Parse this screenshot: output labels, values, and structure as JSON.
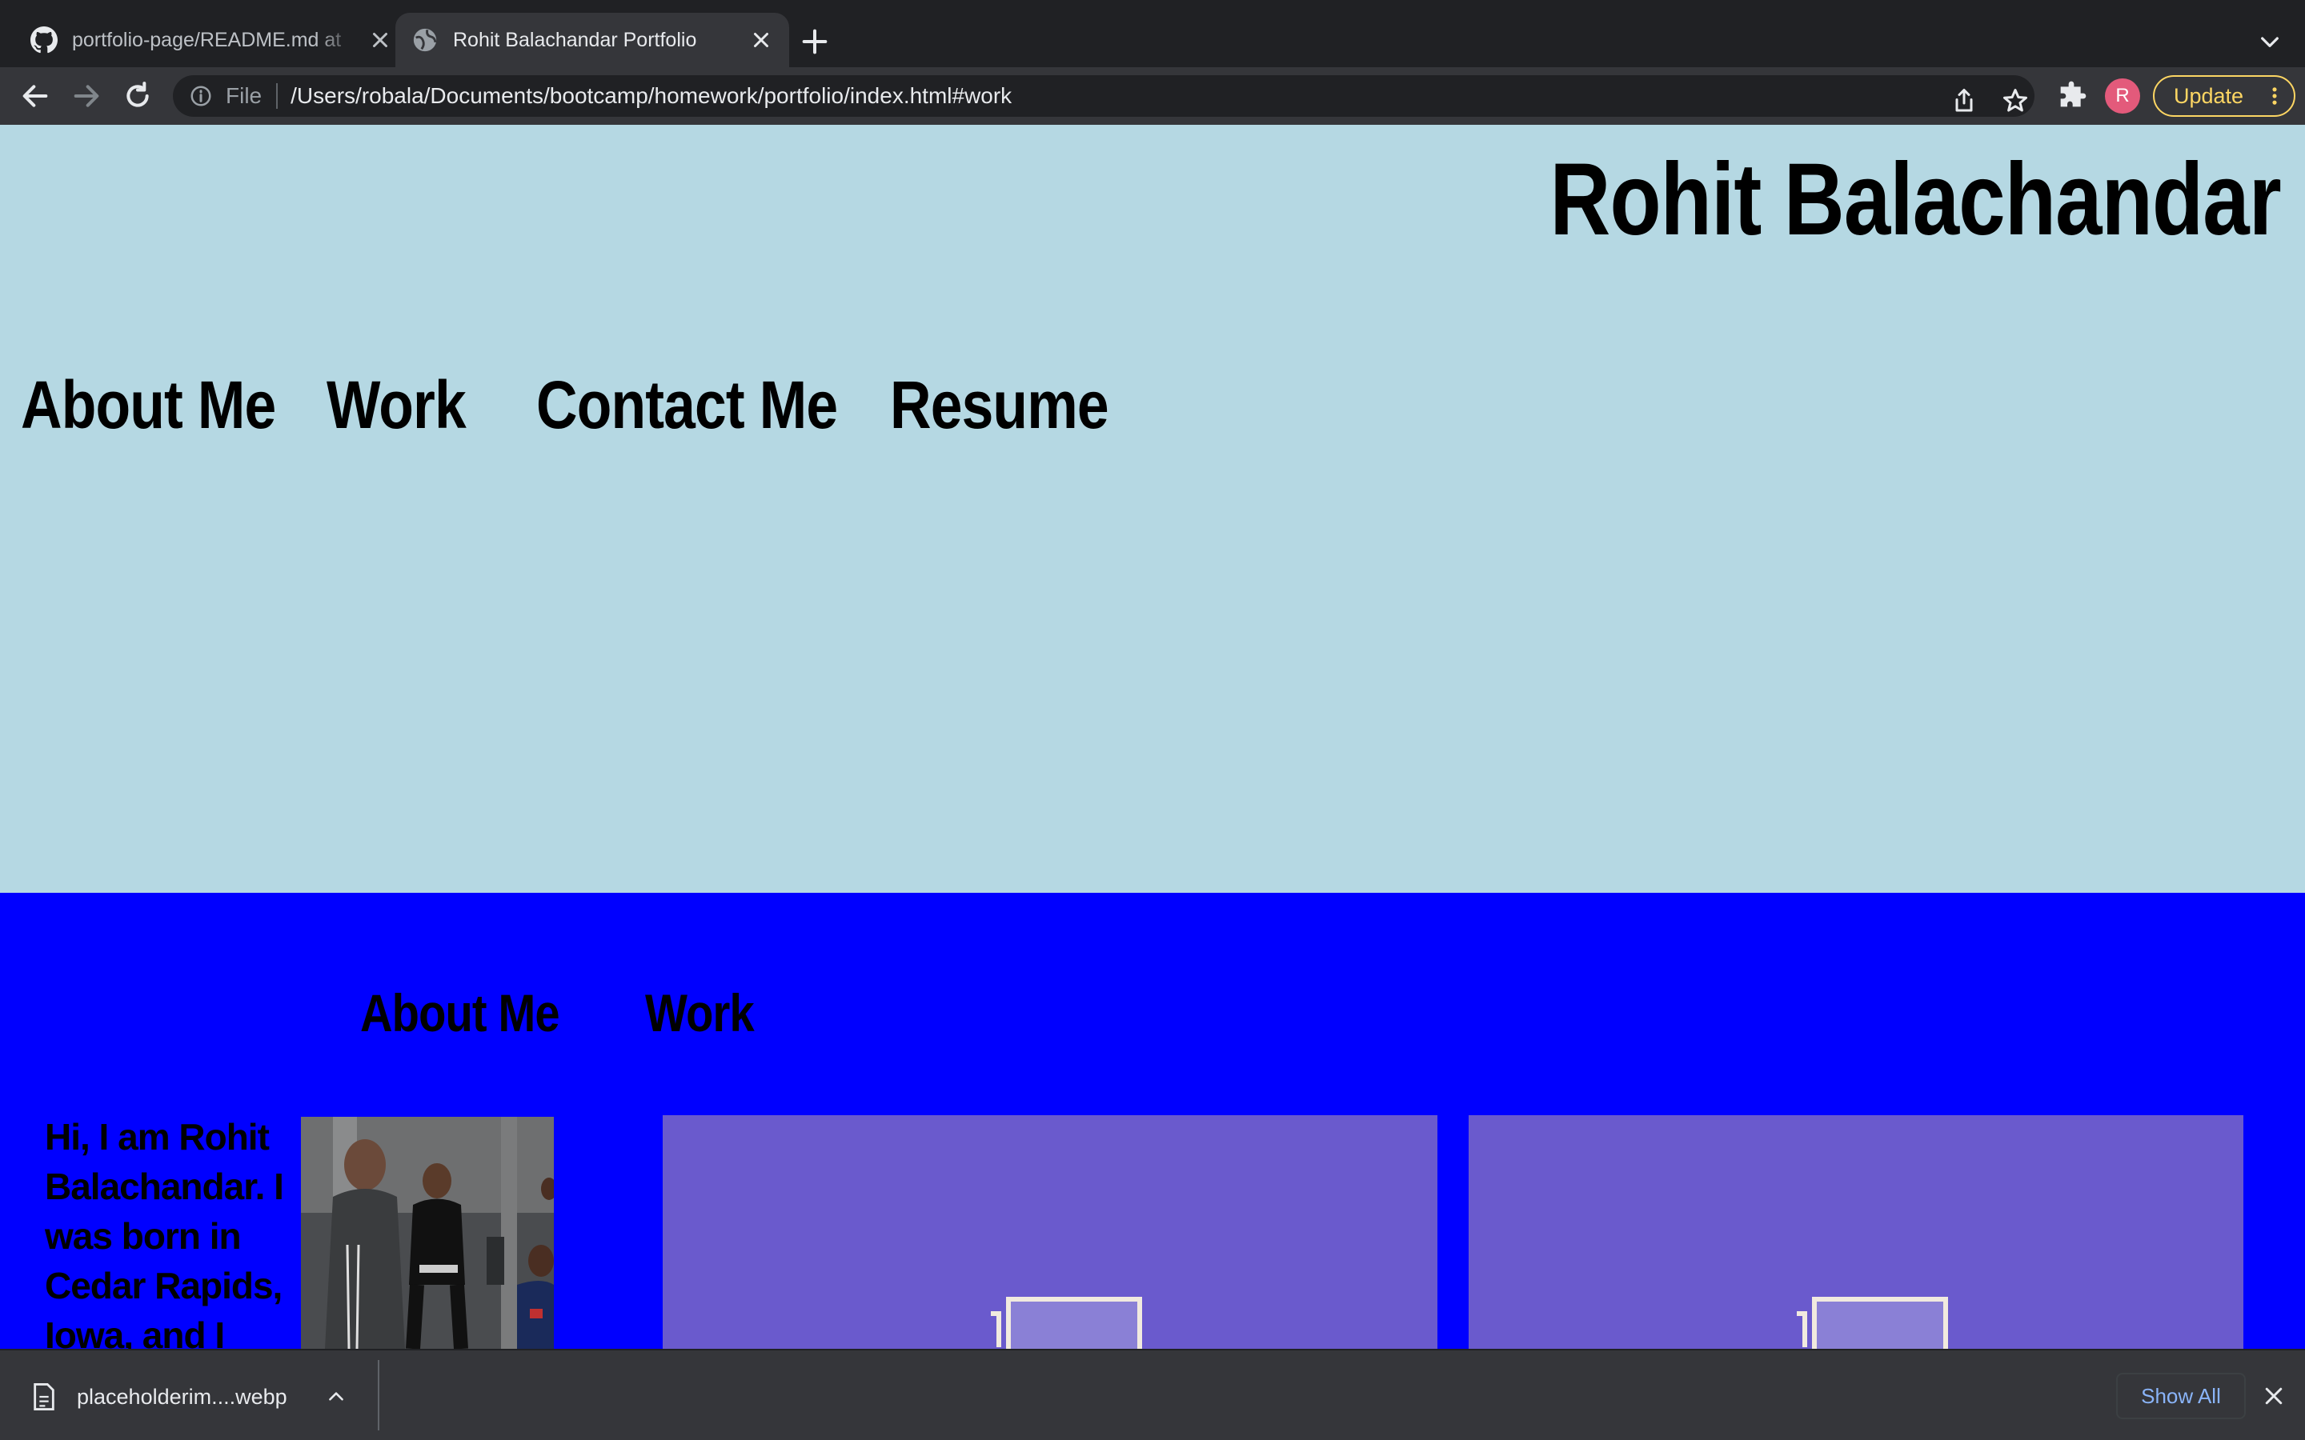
{
  "browser": {
    "tabs": [
      {
        "title": "portfolio-page/README.md at ",
        "icon": "github-icon",
        "active": false
      },
      {
        "title": "Rohit Balachandar Portfolio",
        "icon": "globe-icon",
        "active": true
      }
    ],
    "omnibox": {
      "scheme": "File",
      "url": "/Users/robala/Documents/bootcamp/homework/portfolio/index.html#work"
    },
    "avatar_letter": "R",
    "update_label": "Update"
  },
  "page": {
    "site_title": "Rohit Balachandar",
    "nav": [
      "About Me",
      "Work",
      "Contact Me",
      "Resume"
    ],
    "sections": {
      "about_heading": "About Me",
      "work_heading": "Work",
      "about_text": "Hi, I am Rohit Balachandar. I was born in Cedar Rapids, Iowa, and I"
    },
    "colors": {
      "hero_bg": "#b5d8e3",
      "main_bg": "#0000ff",
      "card_bg": "#6a5acd"
    }
  },
  "downloads": {
    "file_name": "placeholderim....webp",
    "show_all_label": "Show All"
  }
}
